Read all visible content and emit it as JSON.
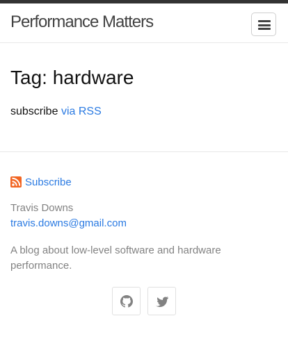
{
  "header": {
    "site_title": "Performance Matters",
    "menu_icon": "hamburger-menu-icon"
  },
  "main": {
    "heading": "Tag: hardware",
    "subscribe_prefix": "subscribe",
    "subscribe_link": "via RSS"
  },
  "footer": {
    "rss_icon": "rss-icon",
    "rss_label": "Subscribe",
    "author_name": "Travis Downs",
    "author_email": "travis.downs@gmail.com",
    "description": "A blog about low-level software and hardware performance.",
    "social": [
      {
        "icon": "github-icon"
      },
      {
        "icon": "twitter-icon"
      }
    ]
  },
  "colors": {
    "link": "#2a7ae2",
    "rss": "#f26522",
    "muted_text": "#828282",
    "topbar": "#333333"
  }
}
